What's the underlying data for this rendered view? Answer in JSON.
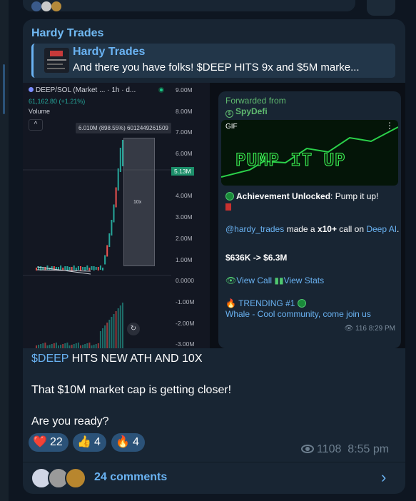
{
  "previous_message": {},
  "post": {
    "sender": "Hardy Trades",
    "reply": {
      "title": "Hardy Trades",
      "text": "And there you have folks!  $DEEP HITS 9x and $5M marke..."
    },
    "chart_image": {
      "symbol": "DEEP/SOL (Market ... · 1h · d...",
      "price": "61,162.80 (+1.21%)",
      "volume_label": "Volume",
      "collapse_icon": "^",
      "tooltip": "6.010M (898.55%) 6012449261509",
      "range_label": "10x",
      "current_price_label": "5.13M",
      "axis_labels": [
        "9.00M",
        "8.00M",
        "7.00M",
        "6.00M",
        "4.00M",
        "3.00M",
        "2.00M",
        "1.00M",
        "0.0000",
        "-1.00M",
        "-2.00M",
        "-3.00M"
      ],
      "refresh_icon": "↻",
      "colors": {
        "up": "#26a69a",
        "down": "#ef5350",
        "bg": "#131722"
      }
    },
    "forwarded": {
      "label": "Forwarded from",
      "source": "SpyDefi",
      "gif_tag": "GIF",
      "gif_banner": "PUMP IT UP",
      "achievement_bold": "Achievement Unlocked",
      "achievement_rest": ": Pump it up!",
      "user": "@hardy_trades",
      "call_text": " made a ",
      "call_bold": "x10+",
      "call_text2": " call on ",
      "call_link": "Deep AI",
      "call_end": ".",
      "marketcap": "$636K -> $6.3M",
      "view_call": "View Call",
      "view_stats": "View Stats",
      "trending": "TRENDING #1",
      "whale": "Whale - Cool community, come join us",
      "views": "116",
      "time": "8:29 PM"
    },
    "body": {
      "cashtag": "$DEEP",
      "line1_rest": " HITS NEW ATH AND 10X",
      "line2": "That $10M market cap is getting closer!",
      "line3": "Are you ready?"
    },
    "reactions": [
      {
        "emoji": "❤️",
        "icon": "heart-icon",
        "count": "22"
      },
      {
        "emoji": "👍",
        "icon": "thumbs-up-icon",
        "count": "4"
      },
      {
        "emoji": "🔥",
        "icon": "fire-icon",
        "count": "4"
      }
    ],
    "views": "1108",
    "time": "8:55 pm",
    "comments": "24 comments"
  }
}
